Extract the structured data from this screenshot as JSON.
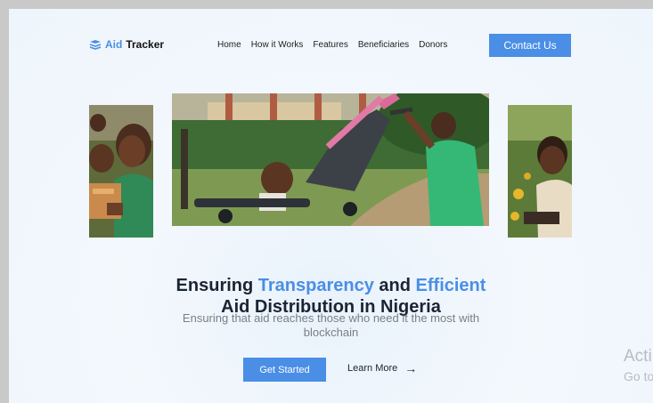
{
  "brand": {
    "part1": "Aid",
    "part2": "Tracker"
  },
  "nav": {
    "items": [
      "Home",
      "How it Works",
      "Features",
      "Beneficiaries",
      "Donors"
    ]
  },
  "header": {
    "contact_label": "Contact Us"
  },
  "hero": {
    "headline": {
      "part1": "Ensuring ",
      "highlight1": "Transparency",
      "part2": " and ",
      "highlight2": "Efficient",
      "line2": "Aid Distribution in Nigeria"
    },
    "subtitle": "Ensuring that aid reaches those who need it the most with blockchain",
    "primary_cta": "Get Started",
    "secondary_cta": "Learn More",
    "secondary_arrow": "→"
  },
  "watermark": {
    "line1": "Acti",
    "line2": "Go to"
  },
  "colors": {
    "accent": "#4a8ee6",
    "text_dark": "#1b2433",
    "muted": "#7a7f87"
  }
}
